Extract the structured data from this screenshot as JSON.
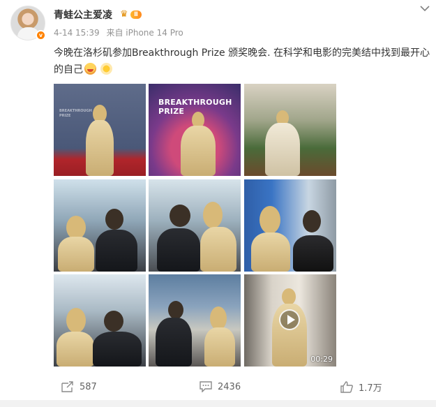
{
  "post": {
    "author": {
      "name": "青蛙公主爱凌",
      "vip_level": "Ⅱ",
      "verified_mark": "v"
    },
    "meta": {
      "timestamp": "4-14 15:39",
      "source": "来自 iPhone 14 Pro"
    },
    "text": "今晚在洛杉矶参加Breakthrough Prize 颁奖晚会. 在科学和电影的完美结中找到最开心的自己",
    "emojis": [
      "grinning-emoji",
      "sparkle-sun-emoji"
    ],
    "media": {
      "count": 9,
      "tile2_logo_line1": "BREAKTHROUGH",
      "tile2_logo_line2": "PRIZE",
      "tile1_wall_text": "BREAKTHROUGH\nPRIZE",
      "video_duration": "00:29"
    },
    "actions": {
      "repost_count": "587",
      "comment_count": "2436",
      "like_count": "1.7万"
    }
  },
  "colors": {
    "name": "#333333",
    "meta": "#939393",
    "action": "#636363",
    "vip": "#ff8a1f"
  },
  "icons": {
    "more": "chevron-down-icon",
    "repost": "repost-icon",
    "comment": "comment-icon",
    "like": "thumbs-up-icon",
    "play": "play-icon"
  }
}
